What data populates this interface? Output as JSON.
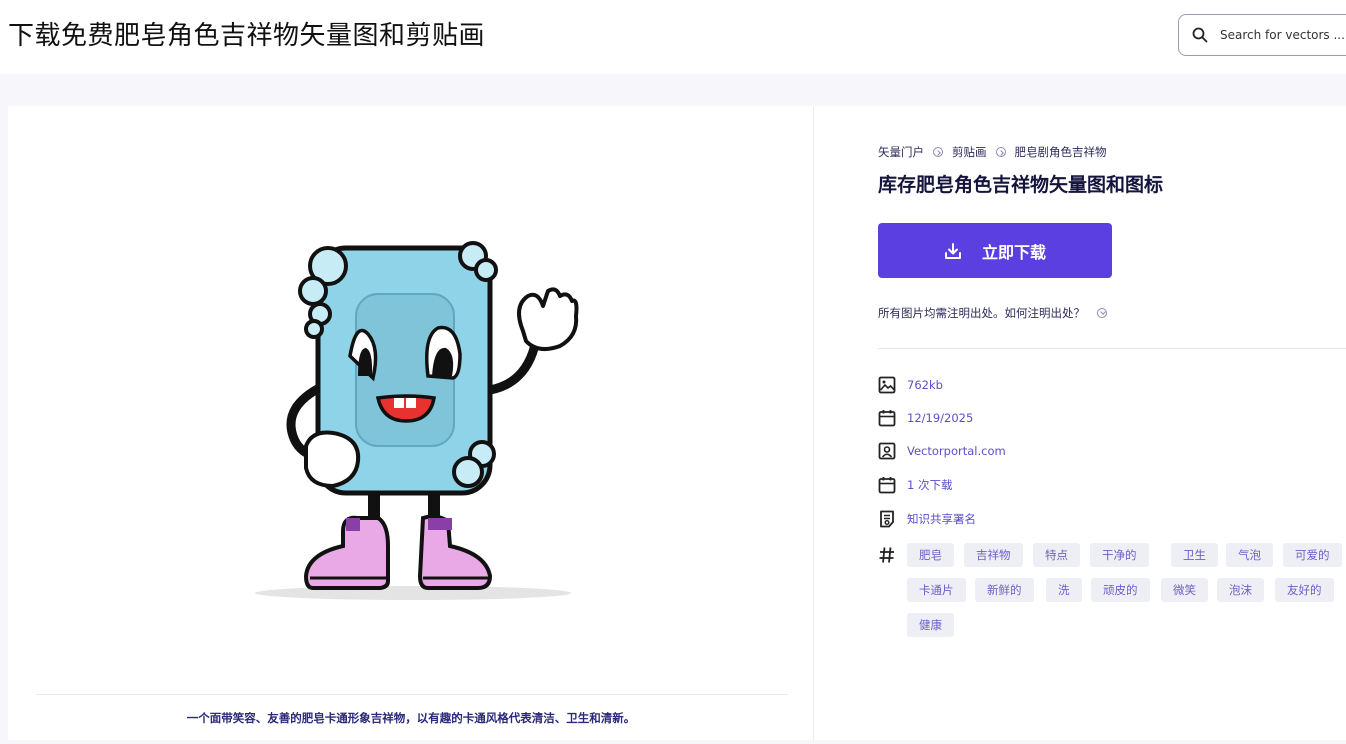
{
  "header": {
    "title": "下载免费肥皂角色吉祥物矢量图和剪贴画",
    "search_placeholder": "Search for vectors ..."
  },
  "image": {
    "caption": "一个面带笑容、友善的肥皂卡通形象吉祥物，以有趣的卡通风格代表清洁、卫生和清新。"
  },
  "details": {
    "breadcrumb": [
      "矢量门户",
      "剪贴画",
      "肥皂剧角色吉祥物"
    ],
    "title": "库存肥皂角色吉祥物矢量图和图标",
    "download_label": "立即下载",
    "attribution_text": "所有图片均需注明出处。如何注明出处？",
    "meta": [
      {
        "icon": "image-icon",
        "text": "762kb"
      },
      {
        "icon": "calendar-icon",
        "text": "12/19/2025"
      },
      {
        "icon": "author-icon",
        "text": "Vectorportal.com"
      },
      {
        "icon": "calendar-icon",
        "text": "1 次下载"
      },
      {
        "icon": "license-icon",
        "text": "知识共享署名"
      }
    ],
    "tags": [
      "肥皂",
      "吉祥物",
      "特点",
      "干净的",
      "卫生",
      "气泡",
      "可爱的",
      "卡通片",
      "新鲜的",
      "洗",
      "顽皮的",
      "微笑",
      "泡沫",
      "友好的",
      "健康"
    ]
  },
  "colors": {
    "accent": "#5b3fe0",
    "link": "#5b4fc8",
    "soap": "#8fd3e8"
  }
}
